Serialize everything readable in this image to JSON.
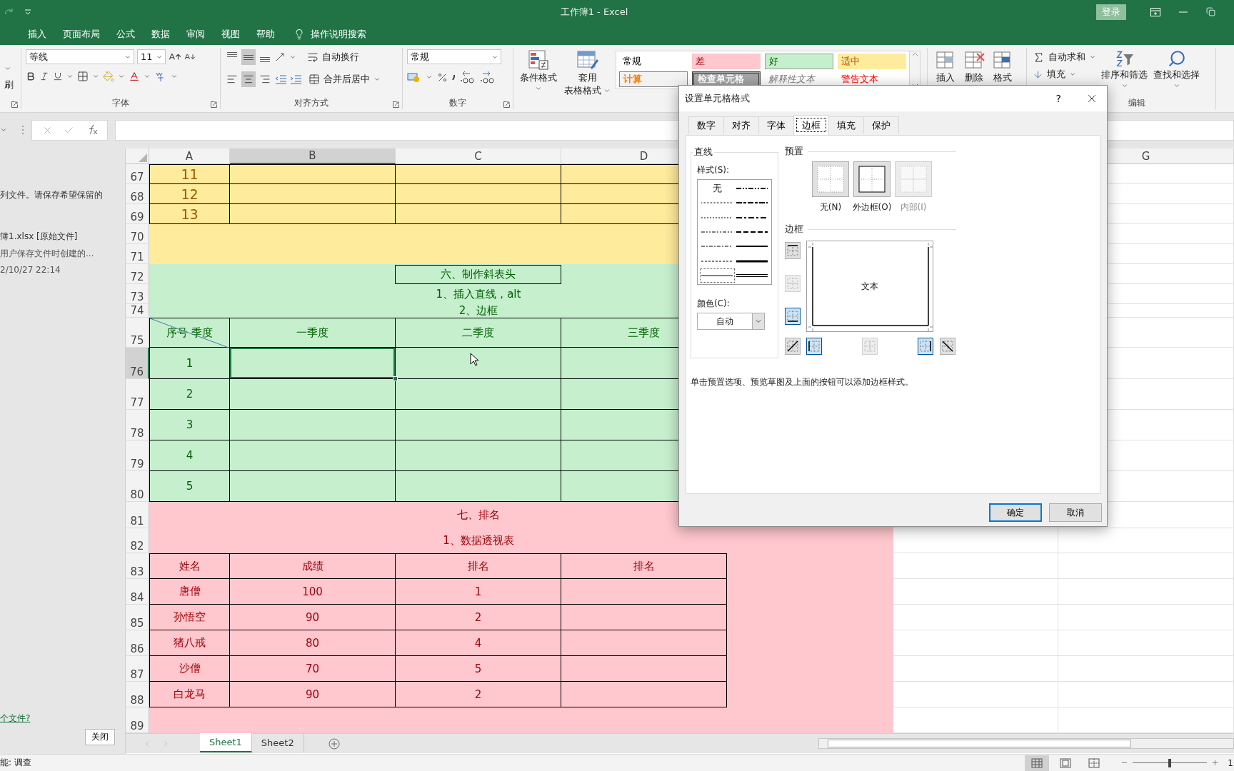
{
  "title_bar": {
    "title": "工作簿1  -  Excel",
    "sign_in": "登录"
  },
  "menu_tabs": [
    "插入",
    "页面布局",
    "公式",
    "数据",
    "审阅",
    "视图",
    "帮助"
  ],
  "tell_me": "操作说明搜索",
  "ribbon": {
    "clipboard": {
      "format_painter": "刷"
    },
    "font": {
      "name": "等线",
      "size": "11",
      "label": "字体"
    },
    "alignment": {
      "vertical": [
        {
          "kind": "top",
          "selected": false
        },
        {
          "kind": "middle",
          "selected": true
        },
        {
          "kind": "bottom",
          "selected": false
        }
      ],
      "horizontal": [
        {
          "kind": "left",
          "selected": false
        },
        {
          "kind": "center",
          "selected": true
        },
        {
          "kind": "right",
          "selected": false
        }
      ],
      "wrap": "自动换行",
      "merge": "合并后居中",
      "label": "对齐方式"
    },
    "number": {
      "format": "常规",
      "label": "数字"
    },
    "styles": {
      "conditional": "条件格式",
      "table": [
        "套用",
        "表格格式"
      ],
      "gallery": [
        {
          "label": "常规",
          "kind": "normal"
        },
        {
          "label": "差",
          "kind": "bad"
        },
        {
          "label": "好",
          "kind": "good"
        },
        {
          "label": "适中",
          "kind": "neutral"
        },
        {
          "label": "计算",
          "kind": "calculation"
        },
        {
          "label": "检查单元格",
          "kind": "check"
        },
        {
          "label": "解释性文本",
          "kind": "explanatory"
        },
        {
          "label": "警告文本",
          "kind": "warning"
        }
      ]
    },
    "cells": [
      "插入",
      "删除",
      "格式"
    ],
    "editing": {
      "autosum": "自动求和",
      "fill": "填充",
      "sort": "排序和筛选",
      "find": "查找和选择",
      "label": "编辑"
    }
  },
  "left_panel": {
    "message": "列文件。请保存希望保留的",
    "file": {
      "name": "簿1.xlsx  [原始文件]",
      "note": "用户保存文件时创建的...",
      "time": "2/10/27 22:14"
    },
    "link": "个文件?",
    "close": "关闭"
  },
  "sheet": {
    "columns": [
      {
        "label": "A",
        "selected": false
      },
      {
        "label": "B",
        "selected": true
      },
      {
        "label": "C",
        "selected": false
      },
      {
        "label": "D",
        "selected": false
      },
      {
        "label": "G",
        "selected": false
      }
    ],
    "rows": [
      {
        "number": "67",
        "selected": false,
        "kind": "large",
        "color": "#ffeb9c",
        "cells": [
          "11",
          "",
          "",
          ""
        ]
      },
      {
        "number": "68",
        "selected": false,
        "kind": "large",
        "color": "#ffeb9c",
        "cells": [
          "12",
          "",
          "",
          ""
        ]
      },
      {
        "number": "69",
        "selected": false,
        "kind": "large",
        "color": "#ffeb9c",
        "cells": [
          "13",
          "",
          "",
          ""
        ]
      },
      {
        "number": "70",
        "selected": false,
        "kind": "band",
        "color": "#ffeb9c"
      },
      {
        "number": "71",
        "selected": false,
        "kind": "band",
        "color": "#ffeb9c"
      },
      {
        "number": "72",
        "selected": false,
        "kind": "band",
        "color": "#c6efce",
        "title": "六、制作斜表头",
        "boxed": true
      },
      {
        "number": "73",
        "selected": false,
        "kind": "band",
        "color": "#c6efce",
        "title": "1、插入直线，alt",
        "boxed": false
      },
      {
        "number": "74",
        "selected": false,
        "kind": "band",
        "color": "#c6efce",
        "title": "2、边框",
        "boxed": false
      },
      {
        "number": "75",
        "selected": false,
        "kind": "diagonal",
        "color": "#c6efce",
        "cells": [
          "序号  季度",
          "一季度",
          "二季度",
          "三季度"
        ]
      },
      {
        "number": "76",
        "selected": true,
        "kind": "cells",
        "color": "#c6efce",
        "cells": [
          "1",
          "",
          "",
          ""
        ]
      },
      {
        "number": "77",
        "selected": false,
        "kind": "cells",
        "color": "#c6efce",
        "cells": [
          "2",
          "",
          "",
          ""
        ]
      },
      {
        "number": "78",
        "selected": false,
        "kind": "cells",
        "color": "#c6efce",
        "cells": [
          "3",
          "",
          "",
          ""
        ]
      },
      {
        "number": "79",
        "selected": false,
        "kind": "cells",
        "color": "#c6efce",
        "cells": [
          "4",
          "",
          "",
          ""
        ]
      },
      {
        "number": "80",
        "selected": false,
        "kind": "cells",
        "color": "#c6efce",
        "cells": [
          "5",
          "",
          "",
          ""
        ]
      },
      {
        "number": "81",
        "selected": false,
        "kind": "band",
        "color": "#ffc7ce",
        "title": "七、排名",
        "boxed": false
      },
      {
        "number": "82",
        "selected": false,
        "kind": "band",
        "color": "#ffc7ce",
        "title": "1、数据透视表",
        "boxed": false
      },
      {
        "number": "83",
        "selected": false,
        "kind": "cells",
        "color": "#ffc7ce",
        "cells": [
          "姓名",
          "成绩",
          "排名",
          "排名"
        ]
      },
      {
        "number": "84",
        "selected": false,
        "kind": "cells",
        "color": "#ffc7ce",
        "cells": [
          "唐僧",
          "100",
          "1",
          ""
        ]
      },
      {
        "number": "85",
        "selected": false,
        "kind": "cells",
        "color": "#ffc7ce",
        "cells": [
          "孙悟空",
          "90",
          "2",
          ""
        ]
      },
      {
        "number": "86",
        "selected": false,
        "kind": "cells",
        "color": "#ffc7ce",
        "cells": [
          "猪八戒",
          "80",
          "4",
          ""
        ]
      },
      {
        "number": "87",
        "selected": false,
        "kind": "cells",
        "color": "#ffc7ce",
        "cells": [
          "沙僧",
          "70",
          "5",
          ""
        ]
      },
      {
        "number": "88",
        "selected": false,
        "kind": "cells",
        "color": "#ffc7ce",
        "cells": [
          "白龙马",
          "90",
          "2",
          ""
        ]
      },
      {
        "number": "89",
        "selected": false,
        "kind": "band",
        "color": "#ffc7ce"
      }
    ]
  },
  "sheet_tabs": [
    {
      "label": "Sheet1",
      "selected": true
    },
    {
      "label": "Sheet2",
      "selected": false
    }
  ],
  "status": {
    "text": "能: 调查",
    "views": [
      {
        "kind": "normal",
        "selected": true
      },
      {
        "kind": "page_layout",
        "selected": false
      },
      {
        "kind": "page_break",
        "selected": false
      }
    ],
    "zoom": {
      "level": 0.5,
      "reading": "1"
    }
  },
  "dialog": {
    "title": "设置单元格格式",
    "help": "?",
    "tabs": [
      {
        "label": "数字",
        "selected": false
      },
      {
        "label": "对齐",
        "selected": false
      },
      {
        "label": "字体",
        "selected": false
      },
      {
        "label": "边框",
        "selected": true
      },
      {
        "label": "填充",
        "selected": false
      },
      {
        "label": "保护",
        "selected": false
      }
    ],
    "line": {
      "label": "直线",
      "style_label": "样式(S):",
      "styles": [
        {
          "kind": "none",
          "label": "无",
          "selected": false
        },
        {
          "kind": "hair",
          "selected": false
        },
        {
          "kind": "dotted",
          "selected": false
        },
        {
          "kind": "dash_dot_dot",
          "selected": false
        },
        {
          "kind": "dash_dot",
          "selected": false
        },
        {
          "kind": "dashed",
          "selected": false
        },
        {
          "kind": "thin",
          "selected": true
        },
        {
          "kind": "medium_dash_dot_dot",
          "selected": false
        },
        {
          "kind": "slant_dash_dot",
          "selected": false
        },
        {
          "kind": "medium_dash_dot",
          "selected": false
        },
        {
          "kind": "medium_dashed",
          "selected": false
        },
        {
          "kind": "medium",
          "selected": false
        },
        {
          "kind": "thick",
          "selected": false
        },
        {
          "kind": "double",
          "selected": false
        }
      ],
      "color_label": "颜色(C):",
      "color_value": "自动"
    },
    "presets": {
      "label": "预置",
      "items": [
        {
          "kind": "none",
          "label": "无(N)",
          "disabled": false
        },
        {
          "kind": "outline",
          "label": "外边框(O)",
          "disabled": false
        },
        {
          "kind": "inside",
          "label": "内部(I)",
          "disabled": true
        }
      ]
    },
    "border": {
      "label": "边框",
      "preview_text": "文本",
      "buttons": [
        {
          "kind": "top",
          "selected": false,
          "disabled": false
        },
        {
          "kind": "middle_h",
          "selected": false,
          "disabled": true
        },
        {
          "kind": "bottom",
          "selected": true,
          "disabled": false
        },
        {
          "kind": "diag_up",
          "selected": false,
          "disabled": false
        },
        {
          "kind": "left",
          "selected": true,
          "disabled": false
        },
        {
          "kind": "middle_v",
          "selected": false,
          "disabled": true
        },
        {
          "kind": "right",
          "selected": true,
          "disabled": false
        },
        {
          "kind": "diag_down",
          "selected": false,
          "disabled": false
        }
      ]
    },
    "note": "单击预置选项、预览草图及上面的按钮可以添加边框样式。",
    "ok": "确定",
    "cancel": "取消"
  }
}
